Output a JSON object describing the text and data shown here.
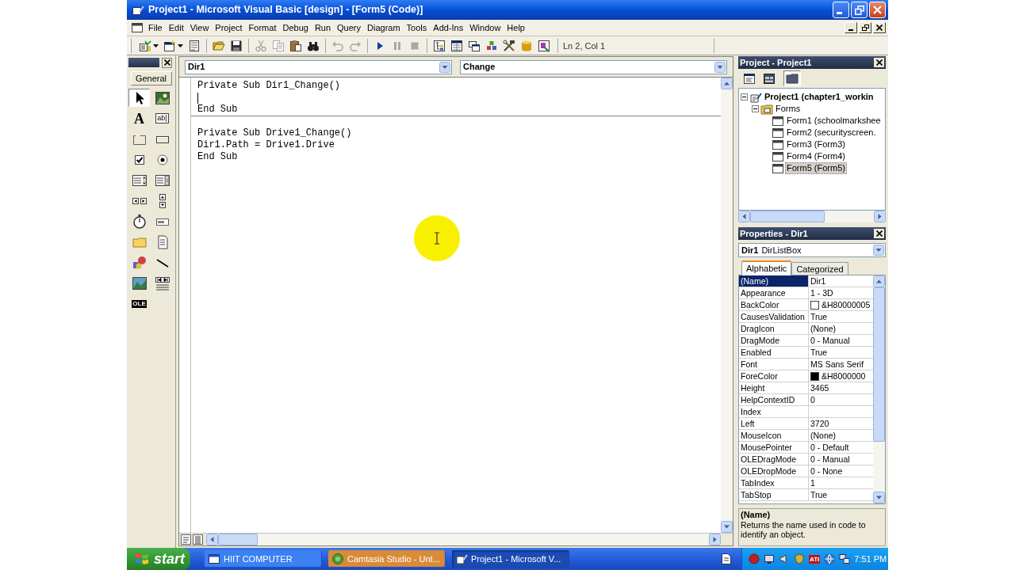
{
  "window": {
    "title": "Project1 - Microsoft Visual Basic [design] - [Form5 (Code)]"
  },
  "menu": [
    {
      "label": "File"
    },
    {
      "label": "Edit"
    },
    {
      "label": "View"
    },
    {
      "label": "Project"
    },
    {
      "label": "Format"
    },
    {
      "label": "Debug"
    },
    {
      "label": "Run"
    },
    {
      "label": "Query"
    },
    {
      "label": "Diagram"
    },
    {
      "label": "Tools"
    },
    {
      "label": "Add-Ins"
    },
    {
      "label": "Window"
    },
    {
      "label": "Help"
    }
  ],
  "toolbar": {
    "groups": [
      {
        "buttons": [
          {
            "kind": "add_project",
            "disabled": false
          },
          {
            "kind": "add_form",
            "disabled": false
          },
          {
            "kind": "menu_editor",
            "disabled": false
          }
        ]
      },
      {
        "buttons": [
          {
            "kind": "open",
            "disabled": false
          },
          {
            "kind": "save",
            "disabled": false
          }
        ]
      },
      {
        "buttons": [
          {
            "kind": "cut",
            "disabled": true
          },
          {
            "kind": "copy",
            "disabled": true
          },
          {
            "kind": "paste",
            "disabled": false
          },
          {
            "kind": "find",
            "disabled": false
          }
        ]
      },
      {
        "buttons": [
          {
            "kind": "undo",
            "disabled": true
          },
          {
            "kind": "redo",
            "disabled": true
          }
        ]
      },
      {
        "buttons": [
          {
            "kind": "start",
            "disabled": false
          },
          {
            "kind": "break",
            "disabled": true
          },
          {
            "kind": "end",
            "disabled": true
          }
        ]
      },
      {
        "buttons": [
          {
            "kind": "project_explorer",
            "disabled": false
          },
          {
            "kind": "properties",
            "disabled": false
          },
          {
            "kind": "form_layout",
            "disabled": false
          },
          {
            "kind": "object_browser",
            "disabled": false
          },
          {
            "kind": "toolbox",
            "disabled": false
          },
          {
            "kind": "data_view",
            "disabled": false
          },
          {
            "kind": "component_manager",
            "disabled": false
          }
        ]
      }
    ],
    "position": "Ln 2, Col 1"
  },
  "toolbox": {
    "tab": "General",
    "tools": [
      {
        "kind": "pointer",
        "selected": true
      },
      {
        "kind": "picture",
        "selected": false
      },
      {
        "kind": "label",
        "glyph": "A",
        "selected": false
      },
      {
        "kind": "textbox",
        "glyph": "ab|",
        "selected": false
      },
      {
        "kind": "frame",
        "selected": false
      },
      {
        "kind": "command",
        "selected": false
      },
      {
        "kind": "checkbox",
        "selected": false
      },
      {
        "kind": "option",
        "selected": false
      },
      {
        "kind": "combo",
        "selected": false
      },
      {
        "kind": "list",
        "selected": false
      },
      {
        "kind": "hscroll",
        "selected": false
      },
      {
        "kind": "vscroll",
        "selected": false
      },
      {
        "kind": "timer",
        "selected": false
      },
      {
        "kind": "drive",
        "selected": false
      },
      {
        "kind": "dir",
        "selected": false
      },
      {
        "kind": "file",
        "selected": false
      },
      {
        "kind": "shape",
        "selected": false
      },
      {
        "kind": "line",
        "selected": false
      },
      {
        "kind": "image",
        "selected": false
      },
      {
        "kind": "data",
        "selected": false
      },
      {
        "kind": "ole",
        "glyph": "OLE",
        "selected": false
      }
    ]
  },
  "code_window": {
    "object": "Dir1",
    "procedure": "Change",
    "procedures": [
      {
        "lines": [
          {
            "text": "Private Sub Dir1_Change()",
            "caret": false
          },
          {
            "caret": true
          },
          {
            "text": "End Sub",
            "caret": false
          }
        ]
      },
      {
        "lines": [
          {
            "text": "Private Sub Drive1_Change()",
            "caret": false
          },
          {
            "text": "Dir1.Path = Drive1.Drive",
            "caret": false
          },
          {
            "text": "End Sub",
            "caret": false
          }
        ]
      }
    ]
  },
  "project_panel": {
    "title": "Project - Project1",
    "toolbar": [
      {
        "kind": "view_code",
        "pressed": false
      },
      {
        "kind": "view_object",
        "pressed": false
      },
      {
        "kind": "toggle_folders",
        "pressed": true
      }
    ],
    "tree": [
      {
        "kind": "project",
        "label": "Project1 (chapter1_workin",
        "expanded": true,
        "selected": false,
        "children": [
          {
            "kind": "folder",
            "label": "Forms",
            "expanded": true,
            "selected": false,
            "children": [
              {
                "kind": "form",
                "label": "Form1 (schoolmarkshee",
                "selected": false
              },
              {
                "kind": "form",
                "label": "Form2 (securityscreen.",
                "selected": false
              },
              {
                "kind": "form",
                "label": "Form3 (Form3)",
                "selected": false
              },
              {
                "kind": "form",
                "label": "Form4 (Form4)",
                "selected": false
              },
              {
                "kind": "form",
                "label": "Form5 (Form5)",
                "selected": true
              }
            ]
          }
        ]
      }
    ]
  },
  "properties_panel": {
    "title": "Properties - Dir1",
    "object": {
      "name": "Dir1",
      "type": "DirListBox"
    },
    "tabs": [
      {
        "label": "Alphabetic",
        "selected": true
      },
      {
        "label": "Categorized",
        "selected": false
      }
    ],
    "rows": [
      {
        "name": "(Name)",
        "value": "Dir1",
        "selected": true
      },
      {
        "name": "Appearance",
        "value": "1 - 3D",
        "selected": false
      },
      {
        "name": "BackColor",
        "value": "&H80000005",
        "color": "#ffffff",
        "selected": false
      },
      {
        "name": "CausesValidation",
        "value": "True",
        "selected": false
      },
      {
        "name": "DragIcon",
        "value": "(None)",
        "selected": false
      },
      {
        "name": "DragMode",
        "value": "0 - Manual",
        "selected": false
      },
      {
        "name": "Enabled",
        "value": "True",
        "selected": false
      },
      {
        "name": "Font",
        "value": "MS Sans Serif",
        "selected": false
      },
      {
        "name": "ForeColor",
        "value": "&H8000000",
        "color": "#000000",
        "selected": false
      },
      {
        "name": "Height",
        "value": "3465",
        "selected": false
      },
      {
        "name": "HelpContextID",
        "value": "0",
        "selected": false
      },
      {
        "name": "Index",
        "selected": false
      },
      {
        "name": "Left",
        "value": "3720",
        "selected": false
      },
      {
        "name": "MouseIcon",
        "value": "(None)",
        "selected": false
      },
      {
        "name": "MousePointer",
        "value": "0 - Default",
        "selected": false
      },
      {
        "name": "OLEDragMode",
        "value": "0 - Manual",
        "selected": false
      },
      {
        "name": "OLEDropMode",
        "value": "0 - None",
        "selected": false
      },
      {
        "name": "TabIndex",
        "value": "1",
        "selected": false
      },
      {
        "name": "TabStop",
        "value": "True",
        "selected": false
      }
    ],
    "description": {
      "title": "(Name)",
      "text": "Returns the name used in code to identify an object."
    }
  },
  "taskbar": {
    "start": "start",
    "tasks": [
      {
        "kind": "explorer",
        "label": "HIIT COMPUTER",
        "selected": false,
        "flashing": false
      },
      {
        "kind": "recorder",
        "label": "Camtasia Studio - Unt...",
        "selected": false,
        "flashing": true
      },
      {
        "kind": "ide",
        "label": "Project1 - Microsoft V...",
        "selected": true,
        "flashing": false
      }
    ],
    "tray": {
      "badge": "ATI",
      "clock": "7:51 PM"
    }
  }
}
